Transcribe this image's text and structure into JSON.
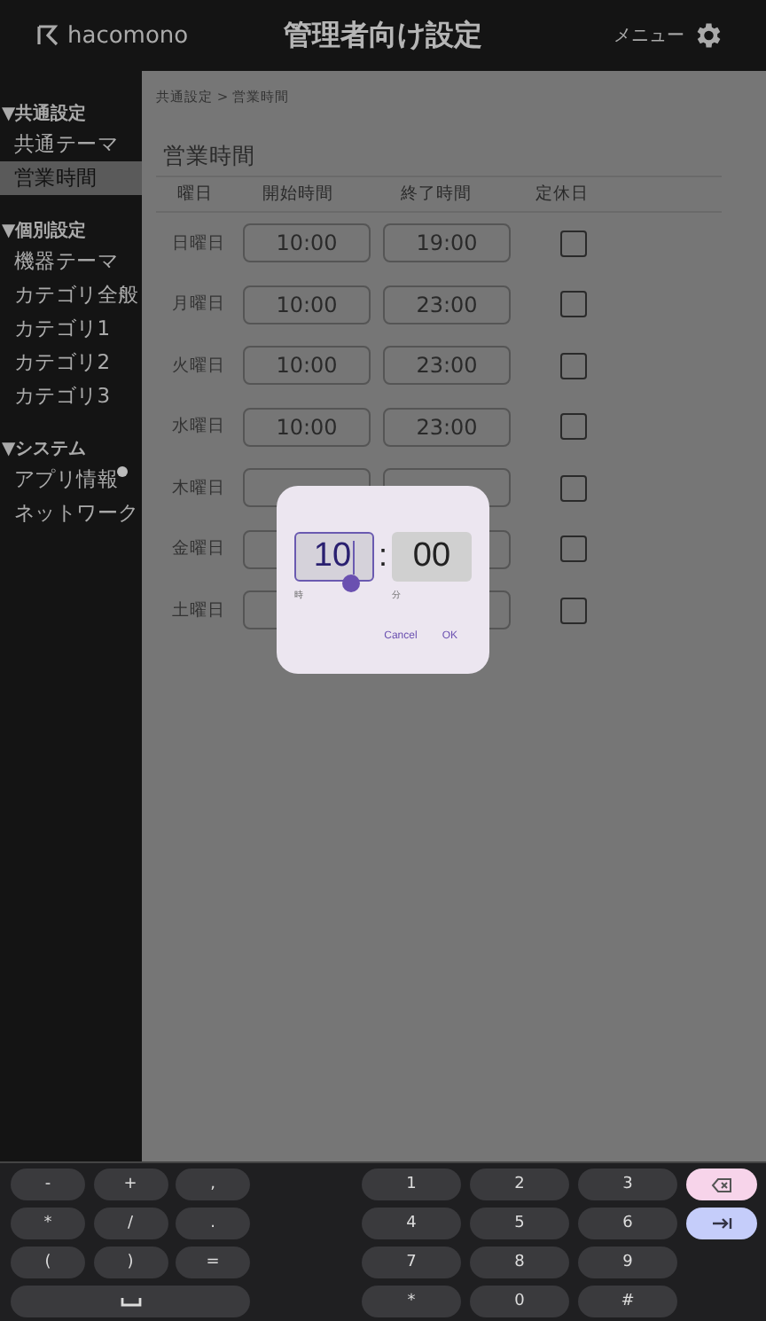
{
  "header": {
    "logo": "hacomono",
    "title": "管理者向け設定",
    "menu": "メニュー"
  },
  "sidebar": [
    {
      "heading": "▼共通設定",
      "items": [
        {
          "label": "共通テーマ",
          "selected": false
        },
        {
          "label": "営業時間",
          "selected": true
        }
      ]
    },
    {
      "heading": "▼個別設定",
      "items": [
        {
          "label": "機器テーマ",
          "selected": false
        },
        {
          "label": "カテゴリ全般",
          "selected": false
        },
        {
          "label": "カテゴリ1",
          "selected": false
        },
        {
          "label": "カテゴリ2",
          "selected": false
        },
        {
          "label": "カテゴリ3",
          "selected": false
        }
      ]
    },
    {
      "heading": "▼システム",
      "items": [
        {
          "label": "アプリ情報",
          "selected": false,
          "badge": true
        },
        {
          "label": "ネットワーク",
          "selected": false
        }
      ]
    }
  ],
  "breadcrumb": "共通設定 > 営業時間",
  "page_title": "営業時間",
  "table": {
    "columns": [
      "曜日",
      "開始時間",
      "終了時間",
      "定休日"
    ],
    "rows": [
      {
        "day": "日曜日",
        "start": "10:00",
        "end": "19:00",
        "closed": false
      },
      {
        "day": "月曜日",
        "start": "10:00",
        "end": "23:00",
        "closed": false
      },
      {
        "day": "火曜日",
        "start": "10:00",
        "end": "23:00",
        "closed": false
      },
      {
        "day": "水曜日",
        "start": "10:00",
        "end": "23:00",
        "closed": false
      },
      {
        "day": "木曜日",
        "closed": false
      },
      {
        "day": "金曜日",
        "closed": false
      },
      {
        "day": "土曜日",
        "closed": false
      }
    ]
  },
  "dialog": {
    "fields": [
      {
        "value": "10",
        "caption": "時",
        "focused": true
      },
      {
        "value": "00",
        "caption": "分",
        "focused": false
      }
    ],
    "separator": ":",
    "buttons": [
      "Cancel",
      "OK"
    ]
  },
  "keyboard": {
    "left": [
      {
        "label": "-",
        "kind": "key"
      },
      {
        "label": "+",
        "kind": "key"
      },
      {
        "label": ",",
        "kind": "key"
      },
      {
        "label": "*",
        "kind": "key"
      },
      {
        "label": "/",
        "kind": "key"
      },
      {
        "label": ".",
        "kind": "key"
      },
      {
        "label": "(",
        "kind": "key"
      },
      {
        "label": ")",
        "kind": "key"
      },
      {
        "label": "=",
        "kind": "key"
      },
      {
        "kind": "space"
      }
    ],
    "right": [
      {
        "label": "1",
        "kind": "key"
      },
      {
        "label": "2",
        "kind": "key"
      },
      {
        "label": "3",
        "kind": "key"
      },
      {
        "kind": "backspace"
      },
      {
        "label": "4",
        "kind": "key"
      },
      {
        "label": "5",
        "kind": "key"
      },
      {
        "label": "6",
        "kind": "key"
      },
      {
        "kind": "tab"
      },
      {
        "label": "7",
        "kind": "key"
      },
      {
        "label": "8",
        "kind": "key"
      },
      {
        "label": "9",
        "kind": "key"
      },
      {
        "kind": "empty"
      },
      {
        "label": "*",
        "kind": "key"
      },
      {
        "label": "0",
        "kind": "key"
      },
      {
        "label": "#",
        "kind": "key"
      }
    ]
  }
}
